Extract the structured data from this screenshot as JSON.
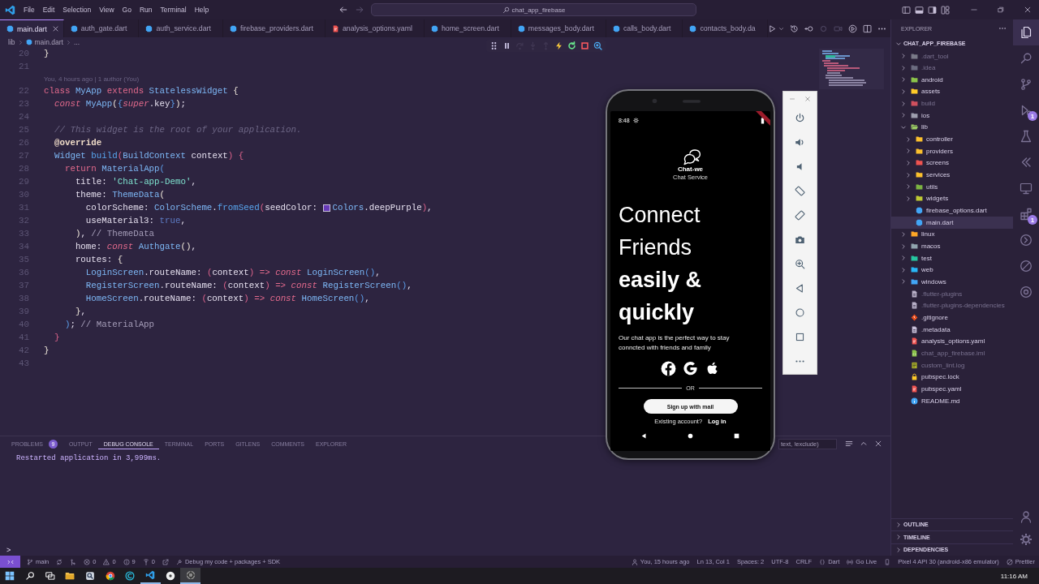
{
  "title_bar": {
    "menu": [
      "File",
      "Edit",
      "Selection",
      "View",
      "Go",
      "Run",
      "Terminal",
      "Help"
    ],
    "nav": [
      {
        "kind": "back",
        "disabled": false
      },
      {
        "kind": "forward",
        "disabled": true
      }
    ],
    "command_center": "chat_app_firebase"
  },
  "tabs": [
    {
      "label": "main.dart",
      "kind": "dart",
      "selected": true
    },
    {
      "label": "auth_gate.dart",
      "kind": "dart",
      "selected": false
    },
    {
      "label": "auth_service.dart",
      "kind": "dart",
      "selected": false
    },
    {
      "label": "firebase_providers.dart",
      "kind": "dart",
      "selected": false
    },
    {
      "label": "analysis_options.yaml",
      "kind": "yaml",
      "selected": false
    },
    {
      "label": "home_screen.dart",
      "kind": "dart",
      "selected": false
    },
    {
      "label": "messages_body.dart",
      "kind": "dart",
      "selected": false
    },
    {
      "label": "calls_body.dart",
      "kind": "dart",
      "selected": false
    },
    {
      "label": "contacts_body.da",
      "kind": "dart",
      "selected": false
    }
  ],
  "editor_actions": [
    {
      "kind": "run",
      "disabled": false
    },
    {
      "kind": "history",
      "disabled": false
    },
    {
      "kind": "back-circle",
      "disabled": false
    },
    {
      "kind": "ring",
      "disabled": true
    },
    {
      "kind": "record",
      "disabled": true
    },
    {
      "kind": "inspect-device",
      "disabled": false
    },
    {
      "kind": "split",
      "disabled": false
    },
    {
      "kind": "more",
      "disabled": false
    }
  ],
  "breadcrumb": [
    {
      "label": "lib",
      "kind": "folder"
    },
    {
      "label": "main.dart",
      "kind": "dart"
    },
    {
      "label": "...",
      "kind": "symbol"
    }
  ],
  "debug_toolbar": [
    {
      "kind": "grip",
      "disabled": false
    },
    {
      "kind": "pause",
      "disabled": false
    },
    {
      "kind": "step-over",
      "disabled": true
    },
    {
      "kind": "step-into",
      "disabled": true
    },
    {
      "kind": "step-out",
      "disabled": true
    },
    {
      "kind": "hot-reload",
      "disabled": false
    },
    {
      "kind": "restart",
      "disabled": false
    },
    {
      "kind": "stop",
      "disabled": false
    },
    {
      "kind": "inspect",
      "disabled": false
    }
  ],
  "code": [
    {
      "kind": "line",
      "number": "20",
      "tokens": [
        {
          "text": "}",
          "kind": "b0"
        }
      ]
    },
    {
      "kind": "line",
      "number": "21"
    },
    {
      "kind": "lens",
      "text": "You, 4 hours ago | 1 author (You)"
    },
    {
      "kind": "line",
      "number": "22",
      "tokens": [
        {
          "text": "class",
          "kind": "kw"
        },
        {
          "text": " MyApp",
          "kind": "type"
        },
        {
          "text": " extends",
          "kind": "kw"
        },
        {
          "text": " StatelessWidget",
          "kind": "type"
        },
        {
          "text": " {",
          "kind": "b0"
        }
      ]
    },
    {
      "kind": "line",
      "number": "23",
      "tokens": [
        {
          "text": "  const",
          "kind": "kwi"
        },
        {
          "text": " MyApp",
          "kind": "type"
        },
        {
          "text": "(",
          "kind": "b0"
        },
        {
          "text": "{",
          "kind": "b2"
        },
        {
          "text": "super",
          "kind": "kwi"
        },
        {
          "text": ".key",
          "kind": "id"
        },
        {
          "text": "}",
          "kind": "b2"
        },
        {
          "text": ")",
          "kind": "b0"
        },
        {
          "text": ";",
          "kind": "p"
        }
      ]
    },
    {
      "kind": "line",
      "number": "24"
    },
    {
      "kind": "line",
      "number": "25",
      "tokens": [
        {
          "text": "  // This widget is the root of your application.",
          "kind": "com"
        }
      ]
    },
    {
      "kind": "line",
      "number": "26",
      "tokens": [
        {
          "text": "  @override",
          "kind": "ann"
        }
      ]
    },
    {
      "kind": "line",
      "number": "27",
      "tokens": [
        {
          "text": "  Widget",
          "kind": "type"
        },
        {
          "text": " build",
          "kind": "fn"
        },
        {
          "text": "(",
          "kind": "b1"
        },
        {
          "text": "BuildContext",
          "kind": "type"
        },
        {
          "text": " context",
          "kind": "id"
        },
        {
          "text": ")",
          "kind": "b1"
        },
        {
          "text": " {",
          "kind": "b1"
        }
      ]
    },
    {
      "kind": "line",
      "number": "28",
      "tokens": [
        {
          "text": "    return",
          "kind": "kw"
        },
        {
          "text": " MaterialApp",
          "kind": "type"
        },
        {
          "text": "(",
          "kind": "b2"
        }
      ]
    },
    {
      "kind": "line",
      "number": "29",
      "tokens": [
        {
          "text": "      title: ",
          "kind": "id"
        },
        {
          "text": "'Chat-app-Demo'",
          "kind": "str"
        },
        {
          "text": ",",
          "kind": "p"
        }
      ]
    },
    {
      "kind": "line",
      "number": "30",
      "tokens": [
        {
          "text": "      theme: ",
          "kind": "id"
        },
        {
          "text": "ThemeData",
          "kind": "type"
        },
        {
          "text": "(",
          "kind": "b0"
        }
      ]
    },
    {
      "kind": "line",
      "number": "31",
      "tokens": [
        {
          "text": "        colorScheme: ",
          "kind": "id"
        },
        {
          "text": "ColorScheme",
          "kind": "type"
        },
        {
          "text": ".",
          "kind": "p"
        },
        {
          "text": "fromSeed",
          "kind": "fn"
        },
        {
          "text": "(",
          "kind": "b1"
        },
        {
          "text": "seedColor: ",
          "kind": "id"
        },
        {
          "kind": "swatch",
          "color": "#673ab7"
        },
        {
          "text": "Colors",
          "kind": "type"
        },
        {
          "text": ".deepPurple",
          "kind": "id"
        },
        {
          "text": ")",
          "kind": "b1"
        },
        {
          "text": ",",
          "kind": "p"
        }
      ]
    },
    {
      "kind": "line",
      "number": "32",
      "tokens": [
        {
          "text": "        useMaterial3: ",
          "kind": "id"
        },
        {
          "text": "true",
          "kind": "lit"
        },
        {
          "text": ",",
          "kind": "p"
        }
      ]
    },
    {
      "kind": "line",
      "number": "33",
      "tokens": [
        {
          "text": "      )",
          "kind": "b0"
        },
        {
          "text": ", ",
          "kind": "p"
        },
        {
          "text": "// ThemeData",
          "kind": "hint"
        }
      ]
    },
    {
      "kind": "line",
      "number": "34",
      "tokens": [
        {
          "text": "      home: ",
          "kind": "id"
        },
        {
          "text": "const",
          "kind": "kwi"
        },
        {
          "text": " Authgate",
          "kind": "type"
        },
        {
          "text": "()",
          "kind": "b0"
        },
        {
          "text": ",",
          "kind": "p"
        }
      ]
    },
    {
      "kind": "line",
      "number": "35",
      "tokens": [
        {
          "text": "      routes: ",
          "kind": "id"
        },
        {
          "text": "{",
          "kind": "b0"
        }
      ]
    },
    {
      "kind": "line",
      "number": "36",
      "tokens": [
        {
          "text": "        LoginScreen",
          "kind": "type"
        },
        {
          "text": ".routeName: ",
          "kind": "id"
        },
        {
          "text": "(",
          "kind": "b1"
        },
        {
          "text": "context",
          "kind": "id"
        },
        {
          "text": ")",
          "kind": "b1"
        },
        {
          "text": " =>",
          "kind": "kw"
        },
        {
          "text": " const",
          "kind": "kwi"
        },
        {
          "text": " LoginScreen",
          "kind": "type"
        },
        {
          "text": "()",
          "kind": "b2"
        },
        {
          "text": ",",
          "kind": "p"
        }
      ]
    },
    {
      "kind": "line",
      "number": "37",
      "tokens": [
        {
          "text": "        RegisterScreen",
          "kind": "type"
        },
        {
          "text": ".routeName: ",
          "kind": "id"
        },
        {
          "text": "(",
          "kind": "b1"
        },
        {
          "text": "context",
          "kind": "id"
        },
        {
          "text": ")",
          "kind": "b1"
        },
        {
          "text": " =>",
          "kind": "kw"
        },
        {
          "text": " const",
          "kind": "kwi"
        },
        {
          "text": " RegisterScreen",
          "kind": "type"
        },
        {
          "text": "()",
          "kind": "b2"
        },
        {
          "text": ",",
          "kind": "p"
        }
      ]
    },
    {
      "kind": "line",
      "number": "38",
      "tokens": [
        {
          "text": "        HomeScreen",
          "kind": "type"
        },
        {
          "text": ".routeName: ",
          "kind": "id"
        },
        {
          "text": "(",
          "kind": "b1"
        },
        {
          "text": "context",
          "kind": "id"
        },
        {
          "text": ")",
          "kind": "b1"
        },
        {
          "text": " =>",
          "kind": "kw"
        },
        {
          "text": " const",
          "kind": "kwi"
        },
        {
          "text": " HomeScreen",
          "kind": "type"
        },
        {
          "text": "()",
          "kind": "b2"
        },
        {
          "text": ",",
          "kind": "p"
        }
      ]
    },
    {
      "kind": "line",
      "number": "39",
      "tokens": [
        {
          "text": "      }",
          "kind": "b0"
        },
        {
          "text": ",",
          "kind": "p"
        }
      ]
    },
    {
      "kind": "line",
      "number": "40",
      "tokens": [
        {
          "text": "    )",
          "kind": "b2"
        },
        {
          "text": ";",
          "kind": "p"
        },
        {
          "text": " // MaterialApp",
          "kind": "hint"
        }
      ]
    },
    {
      "kind": "line",
      "number": "41",
      "tokens": [
        {
          "text": "  }",
          "kind": "b1"
        }
      ]
    },
    {
      "kind": "line",
      "number": "42",
      "tokens": [
        {
          "text": "}",
          "kind": "b0"
        }
      ]
    },
    {
      "kind": "line",
      "number": "43"
    }
  ],
  "emulator": {
    "status_time": "8:48",
    "app_name": "Chat-we",
    "app_tagline": "Chat Service",
    "headline": "Connect Friends **easily & quickly**",
    "description": "Our chat app is the perfect way to stay conncted with friends and family",
    "divider_label": "OR",
    "signup_button": "Sign up with mail",
    "login_prompt": "Existing account?",
    "login_link": "Log in"
  },
  "panel": {
    "tabs": [
      {
        "label": "PROBLEMS",
        "selected": false,
        "badge": "9"
      },
      {
        "label": "OUTPUT",
        "selected": false
      },
      {
        "label": "DEBUG CONSOLE",
        "selected": true
      },
      {
        "label": "TERMINAL",
        "selected": false
      },
      {
        "label": "PORTS",
        "selected": false
      },
      {
        "label": "GITLENS",
        "selected": false
      },
      {
        "label": "COMMENTS",
        "selected": false
      },
      {
        "label": "EXPLORER",
        "selected": false
      }
    ],
    "filter_placeholder": "text, !exclude)",
    "output": [
      "Restarted application in 3,999ms."
    ],
    "prompt": ">"
  },
  "explorer": {
    "title": "EXPLORER",
    "root": {
      "label": "CHAT_APP_FIREBASE",
      "expanded": true
    },
    "items": [
      {
        "name": ".dart_tool",
        "kind": "folder",
        "color": "#7a7a88",
        "expanded": false,
        "selected": false,
        "dimmed": true
      },
      {
        "name": ".idea",
        "kind": "folder",
        "color": "#6c6c80",
        "expanded": false,
        "selected": false,
        "dimmed": true
      },
      {
        "name": "android",
        "kind": "folder",
        "color": "#8bc34a",
        "expanded": false,
        "selected": false,
        "dimmed": false
      },
      {
        "name": "assets",
        "kind": "folder",
        "color": "#ffca28",
        "expanded": false,
        "selected": false,
        "dimmed": false
      },
      {
        "name": "build",
        "kind": "folder",
        "color": "#d0505e",
        "expanded": false,
        "selected": false,
        "dimmed": true
      },
      {
        "name": "ios",
        "kind": "folder",
        "color": "#9e9eae",
        "expanded": false,
        "selected": false,
        "dimmed": false
      },
      {
        "name": "lib",
        "kind": "folder",
        "color": "#9ccc65",
        "expanded": true,
        "selected": false,
        "dimmed": false,
        "children": [
          {
            "name": "controller",
            "kind": "folder",
            "color": "#fbc02d",
            "expanded": false,
            "selected": false,
            "dimmed": false
          },
          {
            "name": "providers",
            "kind": "folder",
            "color": "#fbc02d",
            "expanded": false,
            "selected": false,
            "dimmed": false
          },
          {
            "name": "screens",
            "kind": "folder",
            "color": "#ef5350",
            "expanded": false,
            "selected": false,
            "dimmed": false
          },
          {
            "name": "services",
            "kind": "folder",
            "color": "#fbc02d",
            "expanded": false,
            "selected": false,
            "dimmed": false
          },
          {
            "name": "utils",
            "kind": "folder",
            "color": "#7cb342",
            "expanded": false,
            "selected": false,
            "dimmed": false
          },
          {
            "name": "widgets",
            "kind": "folder",
            "color": "#c0ca33",
            "expanded": false,
            "selected": false,
            "dimmed": false
          },
          {
            "name": "firebase_options.dart",
            "kind": "dart",
            "color": "#42a5f5",
            "selected": false,
            "dimmed": false
          },
          {
            "name": "main.dart",
            "kind": "dart",
            "color": "#42a5f5",
            "selected": true,
            "dimmed": false
          }
        ]
      },
      {
        "name": "linux",
        "kind": "folder",
        "color": "#ffa726",
        "expanded": false,
        "selected": false,
        "dimmed": false
      },
      {
        "name": "macos",
        "kind": "folder",
        "color": "#90a4ae",
        "expanded": false,
        "selected": false,
        "dimmed": false
      },
      {
        "name": "test",
        "kind": "folder",
        "color": "#26c6a0",
        "expanded": false,
        "selected": false,
        "dimmed": false
      },
      {
        "name": "web",
        "kind": "folder",
        "color": "#29b6f6",
        "expanded": false,
        "selected": false,
        "dimmed": false
      },
      {
        "name": "windows",
        "kind": "folder",
        "color": "#42a5f5",
        "expanded": false,
        "selected": false,
        "dimmed": false
      },
      {
        "name": ".flutter-plugins",
        "kind": "file",
        "color": "#b8b0c8",
        "selected": false,
        "dimmed": true
      },
      {
        "name": ".flutter-plugins-dependencies",
        "kind": "file",
        "color": "#b8b0c8",
        "selected": false,
        "dimmed": true
      },
      {
        "name": ".gitignore",
        "kind": "git",
        "color": "#e64a19",
        "selected": false,
        "dimmed": false
      },
      {
        "name": ".metadata",
        "kind": "file",
        "color": "#c8c0d8",
        "selected": false,
        "dimmed": false
      },
      {
        "name": "analysis_options.yaml",
        "kind": "yaml",
        "color": "#ef5350",
        "selected": false,
        "dimmed": false
      },
      {
        "name": "chat_app_firebase.iml",
        "kind": "xml",
        "color": "#8bc34a",
        "selected": false,
        "dimmed": true
      },
      {
        "name": "custom_lint.log",
        "kind": "log",
        "color": "#afb42b",
        "selected": false,
        "dimmed": true
      },
      {
        "name": "pubspec.lock",
        "kind": "lock",
        "color": "#ffca28",
        "selected": false,
        "dimmed": false
      },
      {
        "name": "pubspec.yaml",
        "kind": "yaml",
        "color": "#ef5350",
        "selected": false,
        "dimmed": false
      },
      {
        "name": "README.md",
        "kind": "info",
        "color": "#42a5f5",
        "selected": false,
        "dimmed": false
      }
    ],
    "sections": [
      {
        "label": "OUTLINE",
        "expanded": false
      },
      {
        "label": "TIMELINE",
        "expanded": false
      },
      {
        "label": "DEPENDENCIES",
        "expanded": false
      }
    ]
  },
  "activity_bar": [
    {
      "kind": "files",
      "selected": true
    },
    {
      "kind": "search",
      "selected": false
    },
    {
      "kind": "source-control",
      "selected": false
    },
    {
      "kind": "run-debug",
      "selected": false,
      "badge": "1"
    },
    {
      "kind": "testing",
      "selected": false
    },
    {
      "kind": "gitlens",
      "selected": false
    },
    {
      "kind": "remote",
      "selected": false
    },
    {
      "kind": "extensions",
      "selected": false,
      "badge": "1"
    },
    {
      "kind": "timeline",
      "selected": false
    },
    {
      "kind": "lint",
      "selected": false
    },
    {
      "kind": "devtools",
      "selected": false
    }
  ],
  "status_bar": {
    "left": [
      {
        "kind": "remote"
      },
      {
        "kind": "branch",
        "text": "main"
      },
      {
        "kind": "sync"
      },
      {
        "kind": "graph"
      },
      {
        "kind": "errors",
        "text": "0"
      },
      {
        "kind": "warnings",
        "text": "0"
      },
      {
        "kind": "infos",
        "text": "9"
      },
      {
        "kind": "ports",
        "text": "0"
      },
      {
        "kind": "share"
      },
      {
        "kind": "debug-mode",
        "text": "Debug my code + packages + SDK"
      }
    ],
    "right": [
      {
        "kind": "blame",
        "text": "You, 15 hours ago"
      },
      {
        "kind": "plain",
        "text": "Ln 13, Col 1"
      },
      {
        "kind": "plain",
        "text": "Spaces: 2"
      },
      {
        "kind": "plain",
        "text": "UTF-8"
      },
      {
        "kind": "plain",
        "text": "CRLF"
      },
      {
        "kind": "language",
        "text": "Dart"
      },
      {
        "kind": "live",
        "text": "Go Live"
      },
      {
        "kind": "device"
      },
      {
        "kind": "plain",
        "text": "Pixel 4 API 30 (android-x86 emulator)"
      },
      {
        "kind": "formatter",
        "text": "Prettier"
      }
    ]
  },
  "taskbar": {
    "apps": [
      {
        "kind": "start",
        "running": false,
        "selected": false
      },
      {
        "kind": "search",
        "running": false,
        "selected": false
      },
      {
        "kind": "task-view",
        "running": false,
        "selected": false
      },
      {
        "kind": "folder",
        "running": false,
        "selected": false
      },
      {
        "kind": "tool",
        "running": false,
        "selected": false
      },
      {
        "kind": "browser",
        "running": false,
        "selected": false
      },
      {
        "kind": "c-app",
        "running": false,
        "selected": false
      },
      {
        "kind": "editor",
        "running": true,
        "selected": false
      },
      {
        "kind": "disc",
        "running": false,
        "selected": false
      },
      {
        "kind": "aperture",
        "running": true,
        "selected": true
      }
    ],
    "clock": "11:16 AM"
  }
}
